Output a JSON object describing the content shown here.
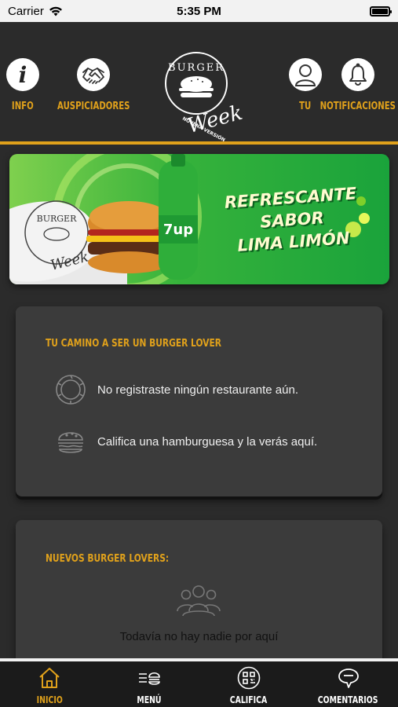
{
  "status_bar": {
    "carrier": "Carrier",
    "time": "5:35 PM"
  },
  "header": {
    "left_buttons": [
      {
        "label": "INFO",
        "icon": "info-icon"
      },
      {
        "label": "AUSPICIADORES",
        "icon": "handshake-icon"
      }
    ],
    "right_buttons": [
      {
        "label": "TU",
        "icon": "user-icon"
      },
      {
        "label": "NOTIFICACIONES",
        "icon": "bell-icon"
      }
    ],
    "logo": {
      "line1": "BURGER",
      "line2": "Week",
      "tagline": "NOVENA VERSIÓN"
    }
  },
  "banner": {
    "headline_line1": "REFRESCANTE SABOR",
    "headline_line2": "LIMA LIMÓN",
    "brand": "7up",
    "sticker_line1": "BURGER",
    "sticker_line2": "Week"
  },
  "lover_card": {
    "title": "TU CAMINO A SER UN BURGER LOVER",
    "items": [
      {
        "icon": "badge-icon",
        "text": "No registraste ningún restaurante aún."
      },
      {
        "icon": "burger-icon",
        "text": "Califica una hamburguesa y la verás aquí."
      }
    ]
  },
  "new_lovers_card": {
    "title": "NUEVOS BURGER LOVERS:",
    "empty_text": "Todavía no hay nadie por aquí"
  },
  "tabs": [
    {
      "label": "INICIO",
      "icon": "home-icon",
      "active": true
    },
    {
      "label": "MENÚ",
      "icon": "menu-icon",
      "active": false
    },
    {
      "label": "CALIFICA",
      "icon": "qr-code-icon",
      "active": false
    },
    {
      "label": "COMENTARIOS",
      "icon": "comment-icon",
      "active": false
    }
  ],
  "colors": {
    "accent": "#e0a11b",
    "background": "#2b2b2b",
    "card": "#3b3b3b"
  }
}
